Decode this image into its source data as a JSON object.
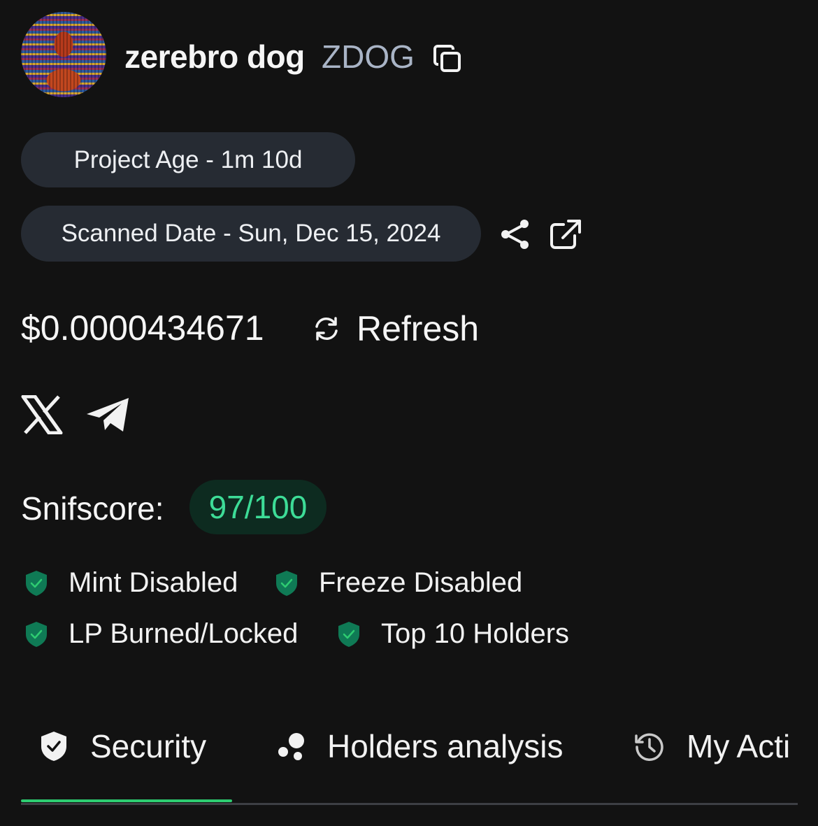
{
  "token": {
    "name": "zerebro dog",
    "symbol": "ZDOG"
  },
  "info": {
    "project_age": "Project Age - 1m 10d",
    "scanned_date": "Scanned Date - Sun, Dec 15, 2024"
  },
  "price": {
    "value": "$0.0000434671",
    "refresh_label": "Refresh"
  },
  "social": {
    "icons": [
      "x-icon",
      "telegram-icon"
    ]
  },
  "snifscore": {
    "label": "Snifscore:",
    "value": "97/100",
    "color": "#3ddc97"
  },
  "checks": [
    {
      "label": "Mint Disabled",
      "icon": "shield-check-icon"
    },
    {
      "label": "Freeze Disabled",
      "icon": "shield-check-icon"
    },
    {
      "label": "LP Burned/Locked",
      "icon": "shield-check-icon"
    },
    {
      "label": "Top 10 Holders",
      "icon": "shield-check-icon"
    }
  ],
  "tabs": [
    {
      "label": "Security",
      "icon": "shield-check-icon",
      "active": true
    },
    {
      "label": "Holders analysis",
      "icon": "bubbles-icon",
      "active": false
    },
    {
      "label": "My Acti",
      "icon": "history-icon",
      "active": false
    }
  ],
  "colors": {
    "background": "#121212",
    "pill": "#262b33",
    "accent_green": "#2ecc71",
    "symbol_gray": "#a9b4c6"
  }
}
